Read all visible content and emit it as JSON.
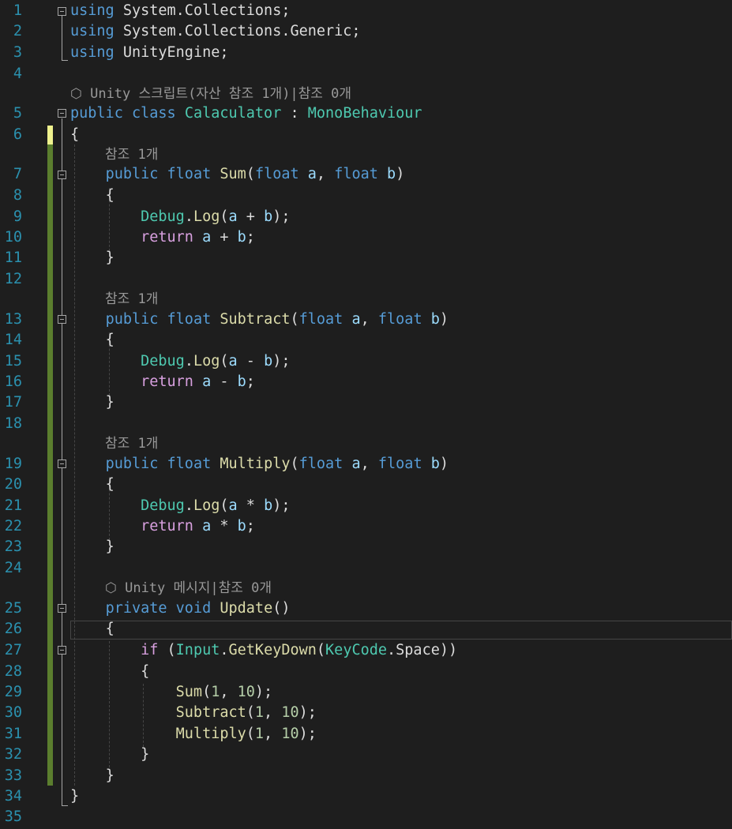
{
  "editor": {
    "line_numbers": [
      "1",
      "2",
      "3",
      "4",
      "5",
      "6",
      "7",
      "8",
      "9",
      "10",
      "11",
      "12",
      "13",
      "14",
      "15",
      "16",
      "17",
      "18",
      "19",
      "20",
      "21",
      "22",
      "23",
      "24",
      "25",
      "26",
      "27",
      "28",
      "29",
      "30",
      "31",
      "32",
      "33",
      "34",
      "35"
    ],
    "codelens": {
      "class_lens": "Unity 스크립트(자산 참조 1개)|참조 0개",
      "sum_refs": "참조 1개",
      "subtract_refs": "참조 1개",
      "multiply_refs": "참조 1개",
      "update_lens": "Unity 메시지|참조 0개"
    },
    "tokens": {
      "using": "using",
      "ns_collections": "System.Collections;",
      "ns_generic": "System.Collections.Generic;",
      "ns_unity": "UnityEngine;",
      "public": "public",
      "class": "class",
      "class_name": "Calaculator",
      "colon": " : ",
      "base_class": "MonoBehaviour",
      "open_brace": "{",
      "close_brace": "}",
      "float": "float",
      "sum": "Sum",
      "subtract": "Subtract",
      "multiply": "Multiply",
      "debug": "Debug",
      "log": "Log",
      "return": "return",
      "private": "private",
      "void": "void",
      "update": "Update",
      "if": "if",
      "input": "Input",
      "getkeydown": "GetKeyDown",
      "keycode": "KeyCode",
      "space": "Space",
      "a": "a",
      "b": "b",
      "num_1": "1",
      "num_10": "10"
    }
  },
  "colors": {
    "background": "#1e1e1e",
    "keyword": "#569cd6",
    "control_keyword": "#d8a0df",
    "type": "#4ec9b0",
    "method": "#dcdcaa",
    "parameter": "#9cdcfe",
    "number": "#b5cea8",
    "line_number": "#2b91af",
    "change_bar": "#5b7e2e",
    "unsaved_bar": "#eff28e"
  }
}
